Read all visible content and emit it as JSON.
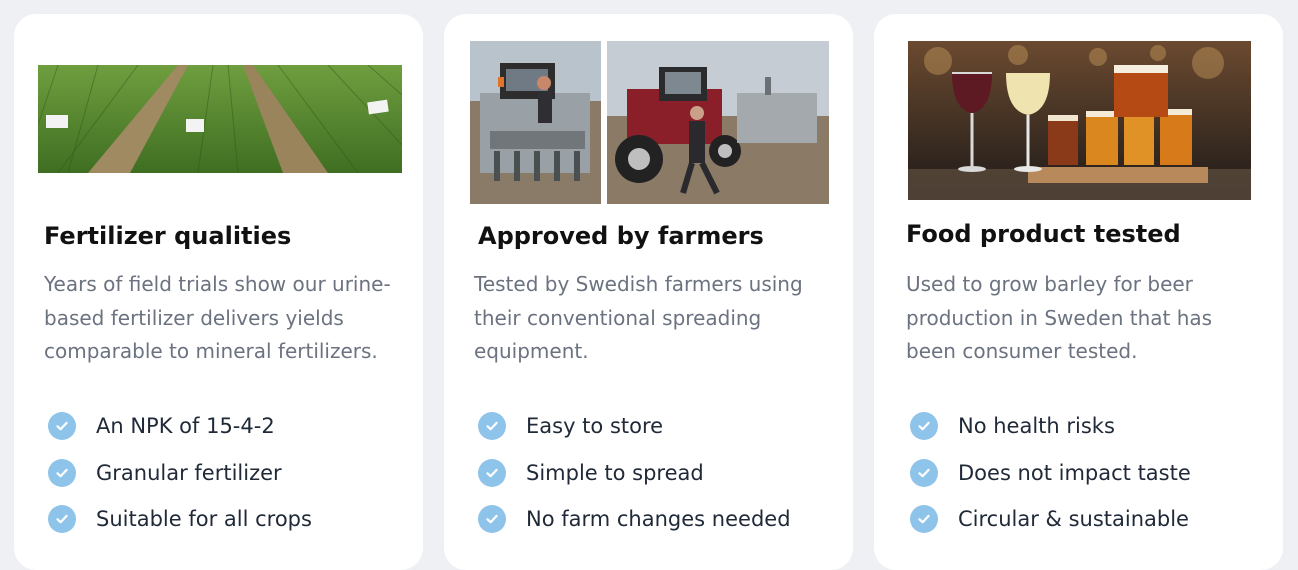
{
  "colors": {
    "page_bg": "#eef0f3",
    "card_bg": "#ffffff",
    "title": "#111111",
    "description": "#6b7280",
    "feature_text": "#1f2937",
    "check_accent": "#8ec3ea"
  },
  "cards": [
    {
      "title": "Fertilizer qualities",
      "description": "Years of field trials show our urine-based fertilizer delivers yields comparable to mineral fertilizers.",
      "features": [
        "An NPK of 15-4-2",
        "Granular fertilizer",
        "Suitable for all crops"
      ]
    },
    {
      "title": "Approved by farmers",
      "description": "Tested by Swedish farmers using their conventional spreading equipment.",
      "features": [
        "Easy to store",
        "Simple to spread",
        "No farm changes needed"
      ]
    },
    {
      "title": "Food product tested",
      "description": "Used to grow barley for beer production in Sweden that has been consumer tested.",
      "features": [
        "No health risks",
        "Does not impact taste",
        "Circular & sustainable"
      ]
    }
  ]
}
